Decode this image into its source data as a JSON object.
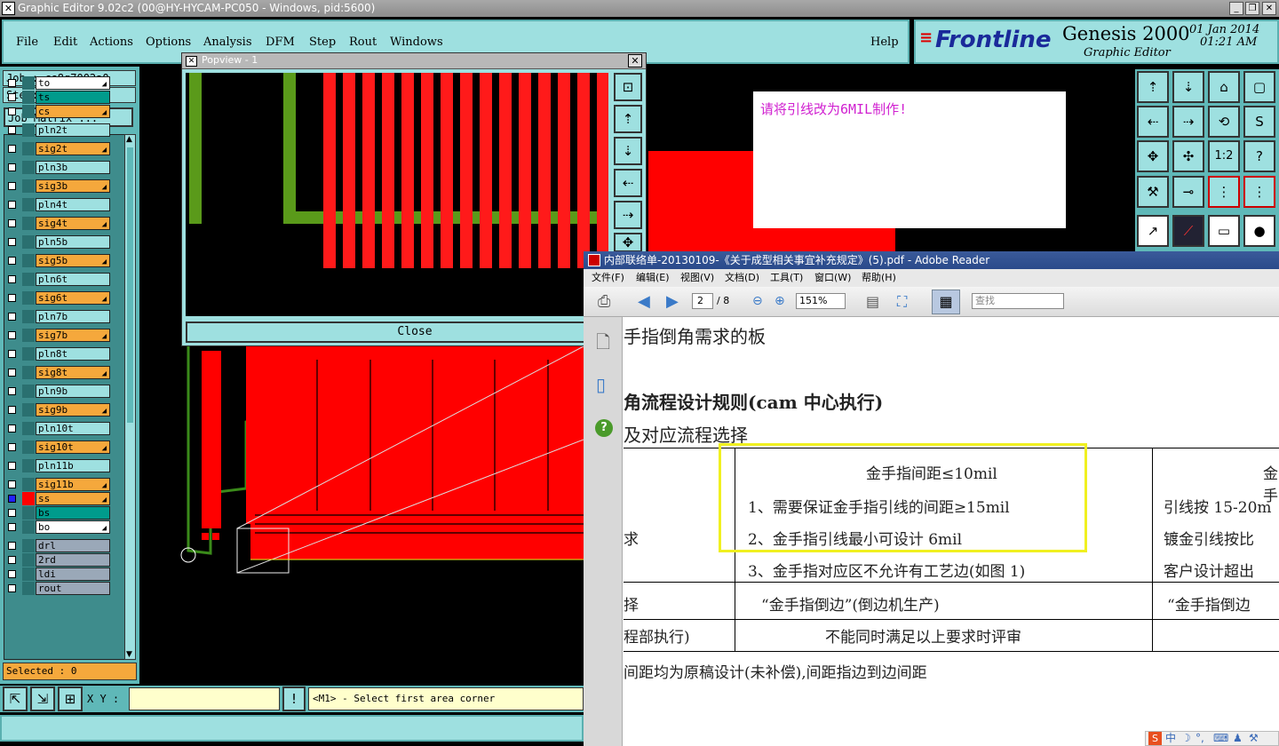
{
  "title_bar": {
    "text": "Graphic Editor 9.02c2 (00@HY-HYCAM-PC050 - Windows, pid:5600)"
  },
  "menu": {
    "items": [
      "File",
      "Edit",
      "Actions",
      "Options",
      "Analysis",
      "DFM",
      "Step",
      "Rout",
      "Windows"
    ],
    "help": "Help"
  },
  "logo": {
    "brand": "Frontline",
    "product": "Genesis 2000",
    "subtitle": "Graphic Editor",
    "date": "01 Jan 2014",
    "time": "01:21 AM"
  },
  "job": {
    "job_label": "Job : cs8q7002a0",
    "step_label": "Step: cam",
    "matrix_button": "Job Matrix ..."
  },
  "layers": [
    {
      "name": "to",
      "color": "#ffffff",
      "arrow": true
    },
    {
      "name": "ts",
      "color": "#009b8c",
      "arrow": false
    },
    {
      "name": "cs",
      "color": "#f5a83c",
      "arrow": true
    },
    {
      "name": "pln2t",
      "color": "#9ee0e0",
      "arrow": false
    },
    {
      "name": "sig2t",
      "color": "#f5a83c",
      "arrow": true
    },
    {
      "name": "pln3b",
      "color": "#9ee0e0",
      "arrow": false
    },
    {
      "name": "sig3b",
      "color": "#f5a83c",
      "arrow": true
    },
    {
      "name": "pln4t",
      "color": "#9ee0e0",
      "arrow": false
    },
    {
      "name": "sig4t",
      "color": "#f5a83c",
      "arrow": true
    },
    {
      "name": "pln5b",
      "color": "#9ee0e0",
      "arrow": false
    },
    {
      "name": "sig5b",
      "color": "#f5a83c",
      "arrow": true
    },
    {
      "name": "pln6t",
      "color": "#9ee0e0",
      "arrow": false
    },
    {
      "name": "sig6t",
      "color": "#f5a83c",
      "arrow": true
    },
    {
      "name": "pln7b",
      "color": "#9ee0e0",
      "arrow": false
    },
    {
      "name": "sig7b",
      "color": "#f5a83c",
      "arrow": true
    },
    {
      "name": "pln8t",
      "color": "#9ee0e0",
      "arrow": false
    },
    {
      "name": "sig8t",
      "color": "#f5a83c",
      "arrow": true
    },
    {
      "name": "pln9b",
      "color": "#9ee0e0",
      "arrow": false
    },
    {
      "name": "sig9b",
      "color": "#f5a83c",
      "arrow": true
    },
    {
      "name": "pln10t",
      "color": "#9ee0e0",
      "arrow": false
    },
    {
      "name": "sig10t",
      "color": "#f5a83c",
      "arrow": true
    },
    {
      "name": "pln11b",
      "color": "#9ee0e0",
      "arrow": false
    },
    {
      "name": "sig11b",
      "color": "#f5a83c",
      "arrow": true
    },
    {
      "name": "ss",
      "color": "#f5a83c",
      "arrow": true
    },
    {
      "name": "bs",
      "color": "#009b8c",
      "arrow": false
    },
    {
      "name": "bo",
      "color": "#ffffff",
      "arrow": true
    },
    {
      "name": "drl",
      "color": "#9aa8b8",
      "arrow": false
    },
    {
      "name": "2rd",
      "color": "#9aa8b8",
      "arrow": false
    },
    {
      "name": "ldi",
      "color": "#9aa8b8",
      "arrow": false
    },
    {
      "name": "rout",
      "color": "#9aa8b8",
      "arrow": false
    }
  ],
  "selected": "Selected : 0",
  "status": {
    "xy_label": "X Y :",
    "prompt": "<M1> - Select first area corner"
  },
  "popview": {
    "title": "Popview - 1",
    "close_label": "Close"
  },
  "note": {
    "text": "请将引线改为6MIL制作!"
  },
  "adobe": {
    "title": "内部联络单-20130109-《关于成型相关事宜补充规定》(5).pdf - Adobe Reader",
    "menu": [
      "文件(F)",
      "编辑(E)",
      "视图(V)",
      "文档(D)",
      "工具(T)",
      "窗口(W)",
      "帮助(H)"
    ],
    "page_current": "2",
    "page_total": "/ 8",
    "zoom": "151%",
    "search_placeholder": "查找",
    "doc": {
      "line1": "手指倒角需求的板",
      "heading": "角流程设计规则(cam 中心执行)",
      "sub": "及对应流程选择",
      "col1_header": "金手指间距≤10mil",
      "col2_header": "金手",
      "row1_c1_l1": "1、需要保证金手指引线的间距≥15mil",
      "row1_c1_l2": "2、金手指引线最小可设计 6mil",
      "row1_c1_l3": "3、金手指对应区不允许有工艺边(如图 1)",
      "row1_c2_l1": "引线按 15-20m",
      "row1_c2_l2": "镀金引线按比",
      "row1_c2_l3": "客户设计超出",
      "row1_left": "求",
      "row2_left": "择",
      "row2_c1": "“金手指倒边”(倒边机生产)",
      "row2_c2": "“金手指倒边",
      "row3_left": "程部执行)",
      "row3_c1": "不能同时满足以上要求时评审",
      "footer": "间距均为原稿设计(未补偿),间距指边到边间距"
    }
  },
  "colors": {
    "cyan": "#9ee0e0",
    "teal": "#5fb8b8",
    "red": "#ff0000",
    "green": "#5a9a1a",
    "highlight": "#f0f020"
  }
}
